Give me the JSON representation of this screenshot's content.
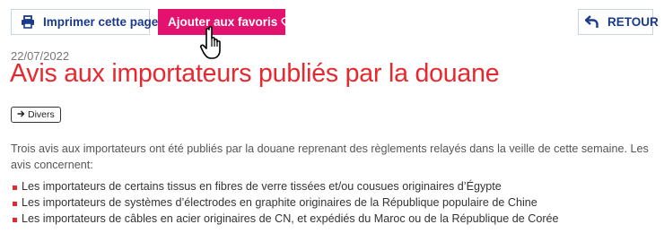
{
  "toolbar": {
    "print_label": "Imprimer cette page",
    "favorite_label": "Ajouter aux favoris",
    "back_label": "RETOUR"
  },
  "article": {
    "date": "22/07/2022",
    "title": "Avis aux importateurs publiés par la douane",
    "tag": "Divers",
    "intro": "Trois avis aux importateurs ont été publiés par la douane reprenant des règlements relayés dans la veille de cette semaine. Les avis concernent:",
    "items": [
      "Les importateurs de certains tissus en fibres de verre tissées et/ou cousues originaires d’Égypte",
      "Les importateurs de systèmes d’électrodes en graphite originaires de la République populaire de Chine",
      "Les importateurs de câbles en acier originaires de CN, et expédiés du Maroc ou de la République de Corée"
    ]
  },
  "colors": {
    "accent_red": "#e8282f",
    "favorite_pink": "#e3126e",
    "button_blue": "#1a3a8c"
  },
  "icons": [
    "printer-icon",
    "heart-icon",
    "back-arrow-icon",
    "arrow-right-icon",
    "hand-pointer-icon"
  ]
}
